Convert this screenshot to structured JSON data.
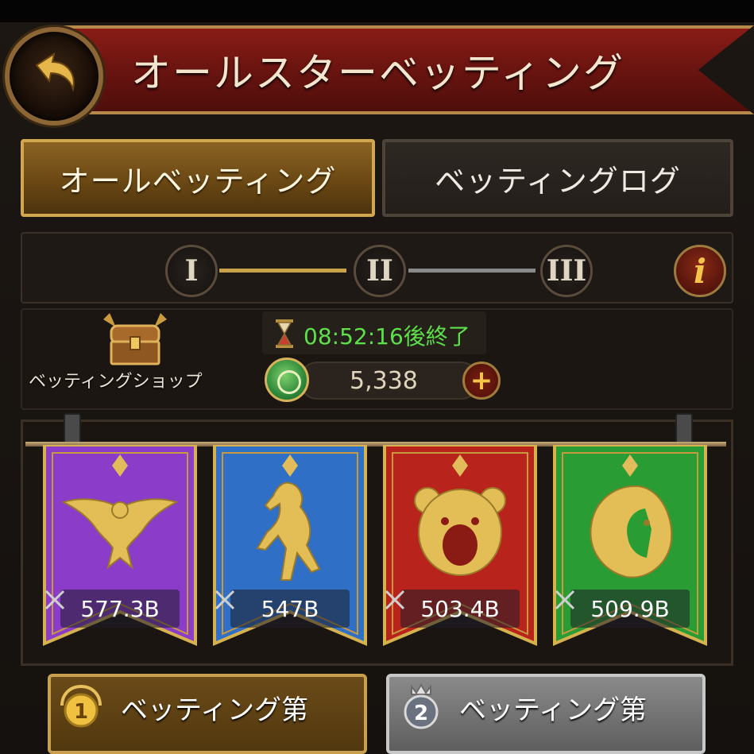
{
  "header": {
    "title": "オールスターベッティング",
    "back_icon": "curved-arrow-back-icon"
  },
  "tabs": [
    {
      "label": "オールベッティング",
      "active": true
    },
    {
      "label": "ベッティングログ",
      "active": false
    }
  ],
  "stages": {
    "nodes": [
      "I",
      "II",
      "III"
    ],
    "current": 2,
    "info_label": "i"
  },
  "shop": {
    "label": "ベッティングショップ",
    "timer": "08:52:16後終了",
    "currency_value": "5,338",
    "plus_label": "+"
  },
  "banners": [
    {
      "emblem": "eagle-icon",
      "color": "#8b3cc8",
      "value": "577.3B"
    },
    {
      "emblem": "horse-icon",
      "color": "#2f6fc6",
      "value": "547B"
    },
    {
      "emblem": "bear-icon",
      "color": "#b8231c",
      "value": "503.4B"
    },
    {
      "emblem": "lion-icon",
      "color": "#2a9c34",
      "value": "509.9B"
    }
  ],
  "cards": [
    {
      "rank": "1",
      "label": "ベッティング第",
      "style": "gold"
    },
    {
      "rank": "2",
      "label": "ベッティング第",
      "style": "silver"
    }
  ],
  "colors": {
    "accent_gold": "#d2a64e",
    "timer_green": "#5ee04a",
    "header_red": "#7a1812"
  }
}
